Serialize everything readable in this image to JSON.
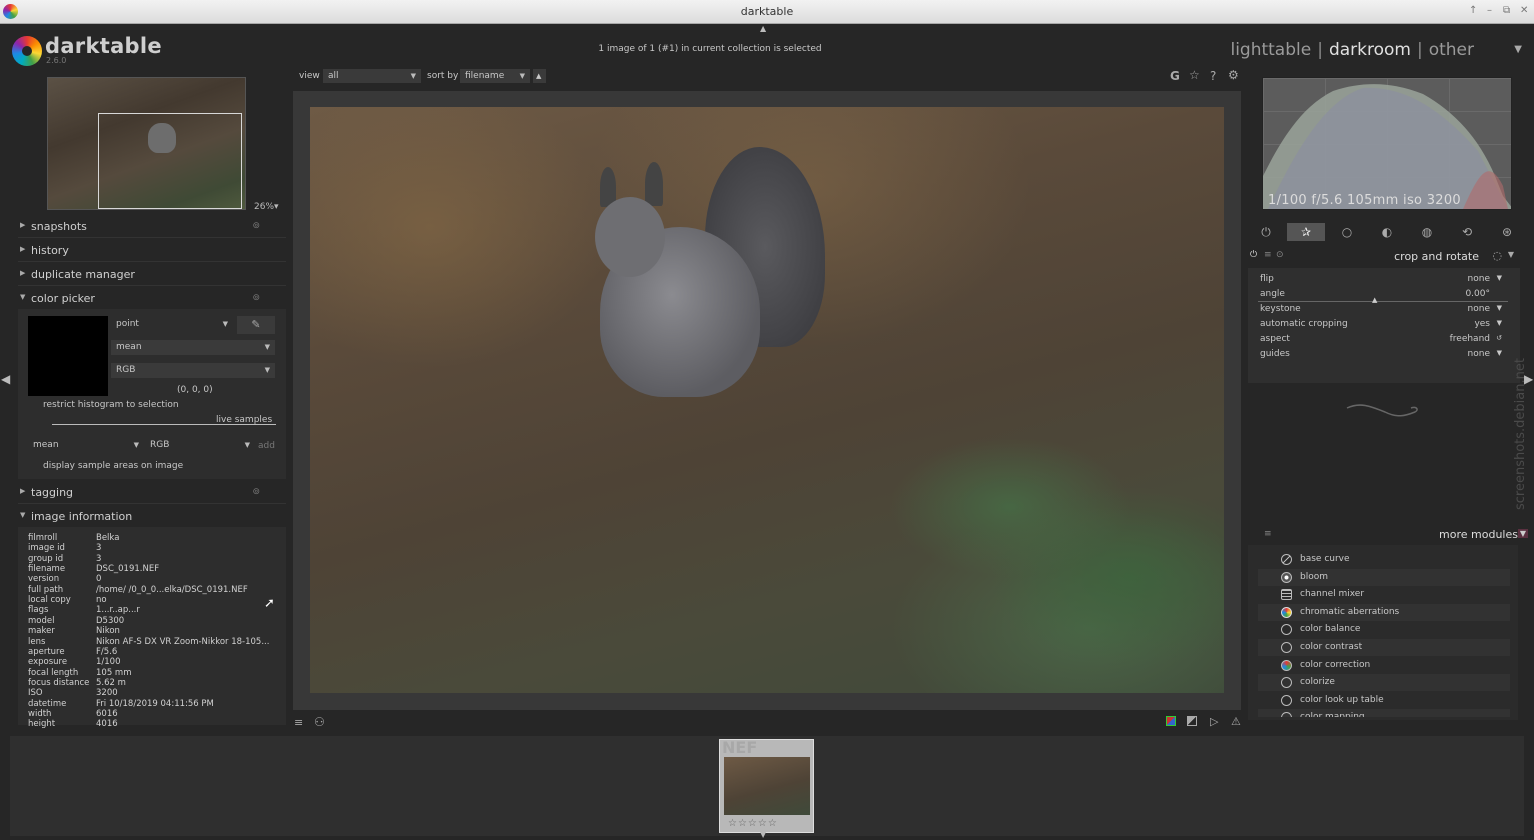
{
  "window": {
    "title": "darktable",
    "buttons": [
      "↑",
      "–",
      "⧉",
      "✕"
    ]
  },
  "header": {
    "logo": "darktable",
    "version": "2.6.0",
    "selection_info": "1 image of 1 (#1) in current collection is selected",
    "views": [
      "lighttable",
      "darkroom",
      "other"
    ],
    "active_view": "darkroom",
    "separator": "|",
    "views_arrow": "▼"
  },
  "left": {
    "zoom": "26%▾",
    "sections": {
      "snapshots": "snapshots",
      "history": "history",
      "duplicate_manager": "duplicate manager",
      "color_picker": "color picker",
      "tagging": "tagging",
      "image_information": "image information"
    },
    "color_picker": {
      "mode": "point",
      "stat": "mean",
      "model": "RGB",
      "value": "(0, 0, 0)",
      "restrict": "restrict histogram to selection",
      "live_samples": "live samples",
      "sample_stat": "mean",
      "sample_model": "RGB",
      "add": "add",
      "display_areas": "display sample areas on image"
    },
    "image_info": [
      {
        "k": "filmroll",
        "v": "Belka"
      },
      {
        "k": "image id",
        "v": "3"
      },
      {
        "k": "group id",
        "v": "3"
      },
      {
        "k": "filename",
        "v": "DSC_0191.NEF"
      },
      {
        "k": "version",
        "v": "0"
      },
      {
        "k": "full path",
        "v": "/home/        /0_0_0...elka/DSC_0191.NEF"
      },
      {
        "k": "local copy",
        "v": "no"
      },
      {
        "k": "flags",
        "v": "1...r..ap...r"
      },
      {
        "k": "model",
        "v": "D5300"
      },
      {
        "k": "maker",
        "v": "Nikon"
      },
      {
        "k": "lens",
        "v": "Nikon AF-S DX VR Zoom-Nikkor 18-105..."
      },
      {
        "k": "aperture",
        "v": "F/5.6"
      },
      {
        "k": "exposure",
        "v": "1/100"
      },
      {
        "k": "focal length",
        "v": "105 mm"
      },
      {
        "k": "focus distance",
        "v": "5.62 m"
      },
      {
        "k": "ISO",
        "v": "3200"
      },
      {
        "k": "datetime",
        "v": "Fri 10/18/2019 04:11:56 PM"
      },
      {
        "k": "width",
        "v": "6016"
      },
      {
        "k": "height",
        "v": "4016"
      }
    ]
  },
  "center": {
    "view_label": "view",
    "view_value": "all",
    "sort_label": "sort by",
    "sort_value": "filename",
    "sort_dir": "▲",
    "top_icons": [
      "G",
      "☆",
      "?",
      "⚙"
    ]
  },
  "right": {
    "histogram_info": "1/100 f/5.6 105mm iso 3200",
    "module_title": "crop and rotate",
    "params": [
      {
        "k": "flip",
        "v": "none"
      },
      {
        "k": "angle",
        "v": "0.00°"
      },
      {
        "k": "keystone",
        "v": "none"
      },
      {
        "k": "automatic cropping",
        "v": "yes"
      },
      {
        "k": "aspect",
        "v": "freehand"
      },
      {
        "k": "guides",
        "v": "none"
      }
    ],
    "more_modules": "more modules",
    "modules": [
      "base curve",
      "bloom",
      "channel mixer",
      "chromatic aberrations",
      "color balance",
      "color contrast",
      "color correction",
      "colorize",
      "color look up table",
      "color mapping"
    ]
  },
  "filmstrip": {
    "ext": "NEF",
    "stars": "☆☆☆☆☆"
  },
  "watermark": "screenshots.debian.net",
  "colors": {
    "accent": "#e0e0e0",
    "bg": "#262626"
  }
}
